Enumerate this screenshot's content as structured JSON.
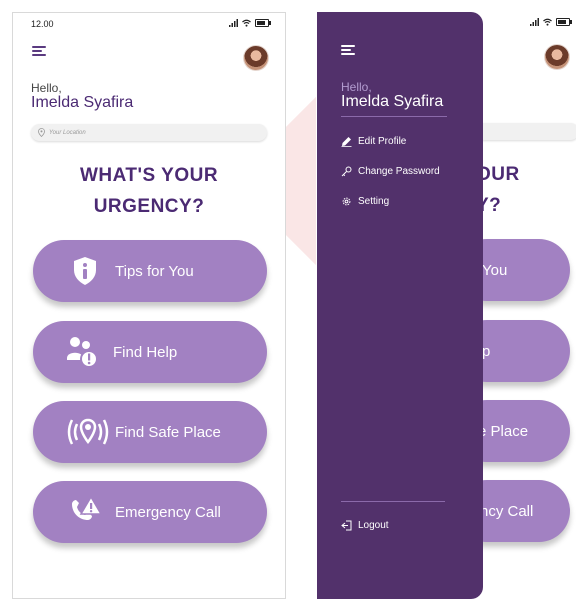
{
  "left": {
    "status_time": "12.00",
    "greeting": "Hello,",
    "user_name": "Imelda Syafira",
    "location_placeholder": "Your Location",
    "question_line1": "WHAT'S YOUR",
    "question_line2": "URGENCY?",
    "actions": [
      {
        "label": "Tips for You",
        "icon": "shield-info-icon"
      },
      {
        "label": "Find Help",
        "icon": "people-alert-icon"
      },
      {
        "label": "Find Safe Place",
        "icon": "location-broadcast-icon"
      },
      {
        "label": "Emergency Call",
        "icon": "phone-alert-icon"
      }
    ]
  },
  "right": {
    "question_line1_visible": "OUR",
    "question_line2_visible": "Y?",
    "actions_visible": [
      "You",
      "p",
      "e Place",
      "ncy Call"
    ]
  },
  "drawer": {
    "greeting": "Hello,",
    "user_name": "Imelda Syafira",
    "items": [
      {
        "label": "Edit Profile",
        "icon": "pencil-icon"
      },
      {
        "label": "Change Password",
        "icon": "key-icon"
      },
      {
        "label": "Setting",
        "icon": "gear-icon"
      }
    ],
    "logout_label": "Logout"
  },
  "colors": {
    "primary": "#4b2a73",
    "button": "#a281c2",
    "drawer": "#52316b"
  }
}
